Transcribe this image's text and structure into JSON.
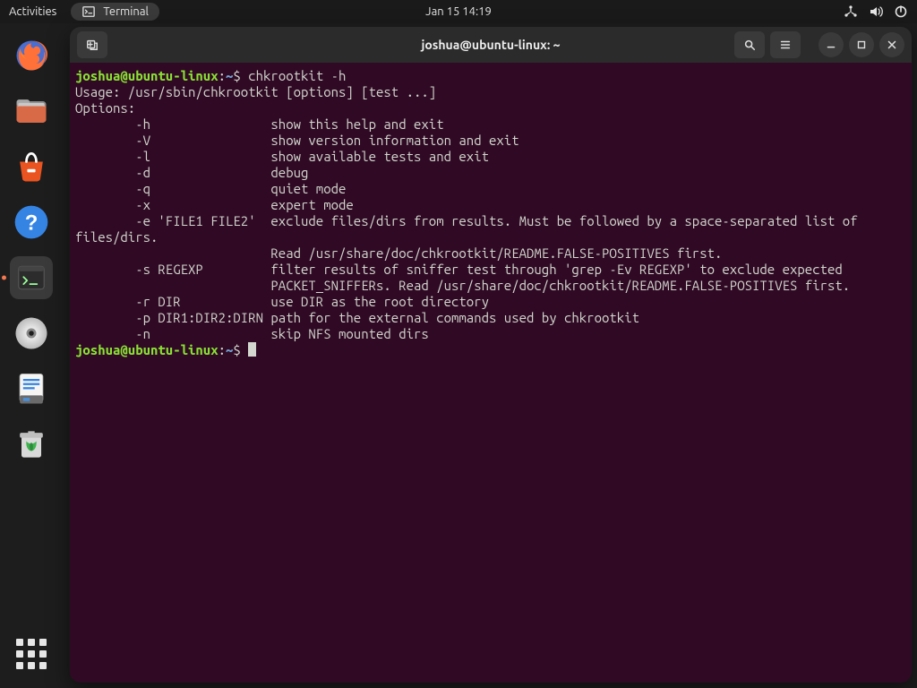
{
  "topbar": {
    "activities": "Activities",
    "terminal_label": "Terminal",
    "clock": "Jan 15  14:19"
  },
  "dock": {
    "items": [
      {
        "name": "firefox"
      },
      {
        "name": "files"
      },
      {
        "name": "software"
      },
      {
        "name": "help"
      },
      {
        "name": "terminal"
      },
      {
        "name": "disc"
      },
      {
        "name": "text-editor"
      },
      {
        "name": "trash"
      }
    ]
  },
  "window": {
    "title": "joshua@ubuntu-linux: ~"
  },
  "prompt": {
    "userhost": "joshua@ubuntu-linux",
    "path": "~",
    "symbol": "$"
  },
  "command": "chkrootkit -h",
  "output": [
    "Usage: /usr/sbin/chkrootkit [options] [test ...]",
    "Options:",
    "        -h                show this help and exit",
    "        -V                show version information and exit",
    "        -l                show available tests and exit",
    "        -d                debug",
    "        -q                quiet mode",
    "        -x                expert mode",
    "        -e 'FILE1 FILE2'  exclude files/dirs from results. Must be followed by a space-separated list of",
    "files/dirs.",
    "                          Read /usr/share/doc/chkrootkit/README.FALSE-POSITIVES first.",
    "        -s REGEXP         filter results of sniffer test through 'grep -Ev REGEXP' to exclude expected",
    "                          PACKET_SNIFFERs. Read /usr/share/doc/chkrootkit/README.FALSE-POSITIVES first.",
    "        -r DIR            use DIR as the root directory",
    "        -p DIR1:DIR2:DIRN path for the external commands used by chkrootkit",
    "        -n                skip NFS mounted dirs"
  ]
}
